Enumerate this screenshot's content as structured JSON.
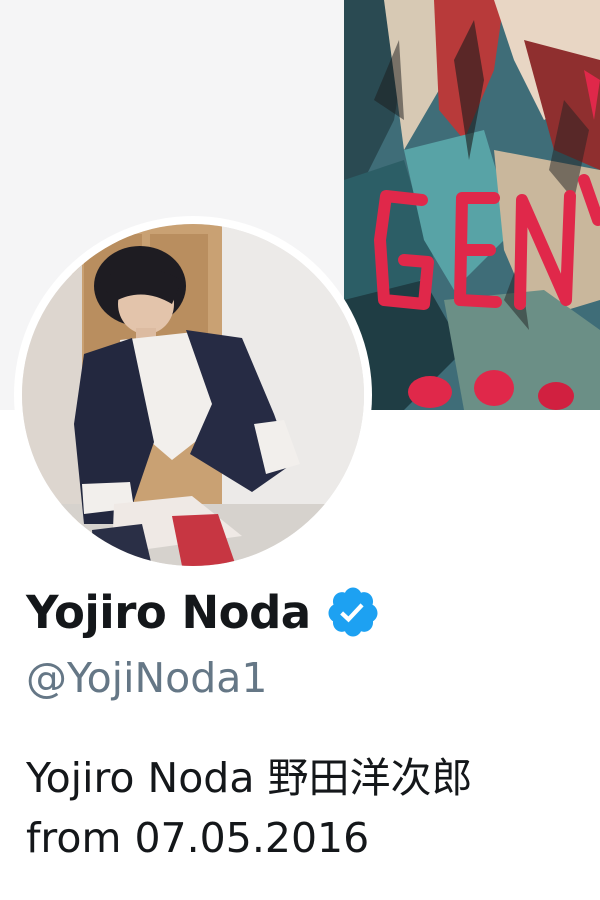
{
  "profile": {
    "display_name": "Yojiro Noda",
    "verified": true,
    "handle": "@YojiNoda1",
    "bio_lines": [
      "Yojiro Noda 野田洋次郎",
      "from 07.05.2016"
    ]
  },
  "banner": {
    "art_text": "GEN"
  },
  "icons": {
    "verified": "verified-badge-icon"
  },
  "colors": {
    "verified_blue": "#1da1f2",
    "handle_gray": "#657786",
    "text_dark": "#14171a",
    "banner_bg": "#f5f5f6"
  }
}
